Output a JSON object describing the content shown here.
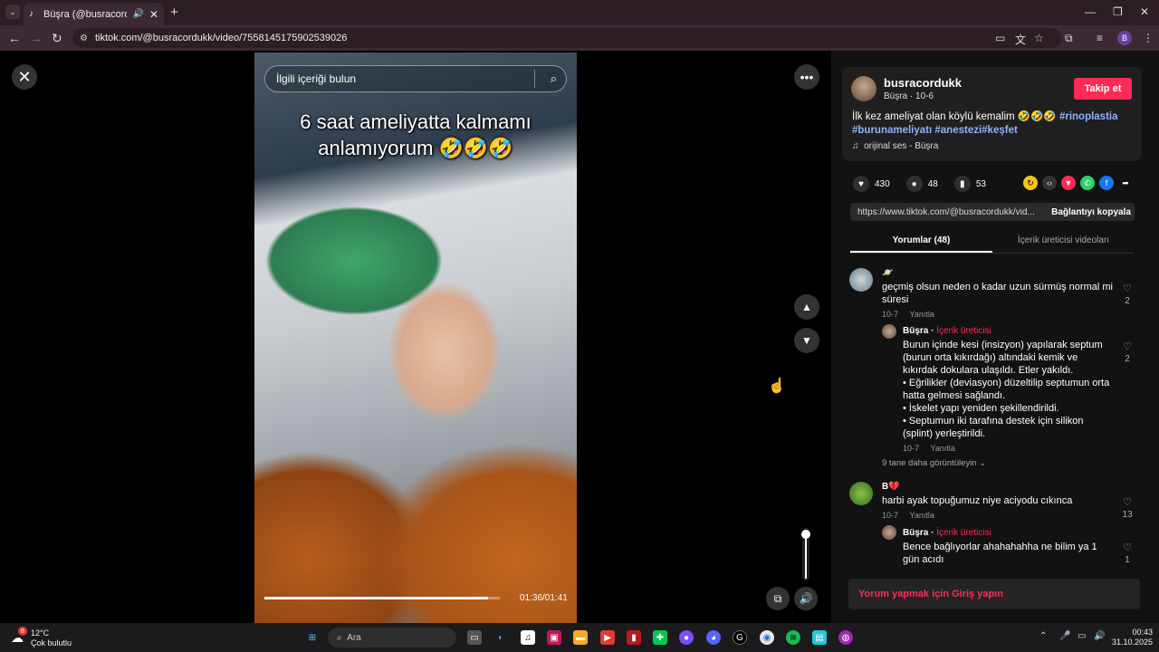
{
  "browser": {
    "tab_title": "Büşra (@busracordukk) | Ti",
    "url": "tiktok.com/@busracordukk/video/7558145175902539026"
  },
  "video": {
    "search_placeholder": "İlgili içeriği bulun",
    "caption": "6 saat ameliyatta kalmamı anlamıyorum 🤣🤣🤣",
    "time": "01:36/01:41",
    "progress": 0.95,
    "volume": 0.9
  },
  "author": {
    "username": "busracordukk",
    "nick_date": "Büşra · 10-6",
    "follow_label": "Takip et",
    "description": "İlk kez ameliyat olan köylü kemalim 🤣🤣🤣 ",
    "tags": "#rinoplastia #burunameliyatı #anestezi#keşfet",
    "sound": "orijinal ses - Büşra"
  },
  "stats": {
    "likes": "430",
    "comments": "48",
    "saves": "53"
  },
  "link": {
    "url": "https://www.tiktok.com/@busracordukk/vid...",
    "copy_label": "Bağlantıyı kopyala"
  },
  "tabs": {
    "comments": "Yorumlar (48)",
    "creator_videos": "İçerik üreticisi videoları"
  },
  "comments": [
    {
      "name": "🪐",
      "text": "geçmiş olsun neden o kadar uzun sürmüş normal mi süresi",
      "date": "10-7",
      "reply": "Yanıtla",
      "likes": "2"
    },
    {
      "name": "Büşra",
      "tag": "İçerik üreticisi",
      "text": "Burun içinde kesi (insizyon) yapılarak septum (burun orta kıkırdağı) altındaki kemik ve kıkırdak dokulara ulaşıldı. Etler yakıldı.\n• Eğrilikler (deviasyon) düzeltilip septumun orta hatta gelmesi sağlandı.\n• İskelet yapı yeniden şekillendirildi.\n• Septumun iki tarafına destek için silikon (splint) yerleştirildi.",
      "date": "10-7",
      "reply": "Yanıtla",
      "likes": "2"
    },
    {
      "name": "B💔",
      "text": "harbi ayak topuğumuz niye aciyodu cıkınca",
      "date": "10-7",
      "reply": "Yanıtla",
      "likes": "13"
    },
    {
      "name": "Büşra",
      "tag": "İçerik üreticisi",
      "text": "Bence bağlıyorlar ahahahahha ne bilim ya 1 gün acıdı",
      "likes": "1"
    }
  ],
  "more_replies": "9 tane daha görüntüleyin",
  "login_prompt": "Yorum yapmak için Giriş yapın",
  "taskbar": {
    "temp": "12°C",
    "weather": "Çok bulutlu",
    "search": "Ara",
    "badge": "8",
    "time": "00:43",
    "date": "31.10.2025"
  },
  "icons": [
    "tiktok-icon",
    "speaker-icon",
    "close-icon",
    "search-icon",
    "more-icon",
    "chevron-up-icon",
    "chevron-down-icon",
    "volume-icon",
    "pip-icon",
    "heart-icon",
    "comment-icon",
    "bookmark-icon",
    "music-note-icon"
  ],
  "colors": {
    "accent": "#fe2c55",
    "link": "#8fb3ff",
    "panel": "#121212"
  }
}
